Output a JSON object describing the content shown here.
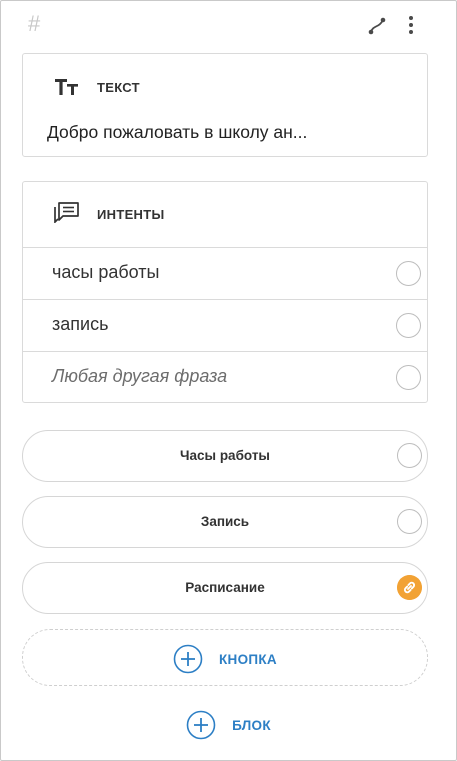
{
  "topbar": {
    "hash_symbol": "#",
    "icons": [
      "connect-icon",
      "more-vertical-icon"
    ]
  },
  "text_card": {
    "icon": "text-size-icon",
    "title": "ТЕКСТ",
    "body": "Добро пожаловать в школу ан..."
  },
  "intents_card": {
    "icon": "chat-list-icon",
    "title": "ИНТЕНТЫ",
    "items": [
      {
        "label": "часы работы"
      },
      {
        "label": "запись"
      },
      {
        "label": "Любая другая фраза"
      }
    ]
  },
  "buttons": [
    {
      "label": "Часы работы",
      "linked": false
    },
    {
      "label": "Запись",
      "linked": false
    },
    {
      "label": "Расписание",
      "linked": true
    }
  ],
  "add_button": {
    "label": "КНОПКА",
    "icon": "plus-circle-icon"
  },
  "add_block": {
    "label": "БЛОК",
    "icon": "plus-circle-icon"
  },
  "colors": {
    "accent": "#2d7fc5",
    "link_badge": "#f2a234",
    "border": "#dadada"
  }
}
